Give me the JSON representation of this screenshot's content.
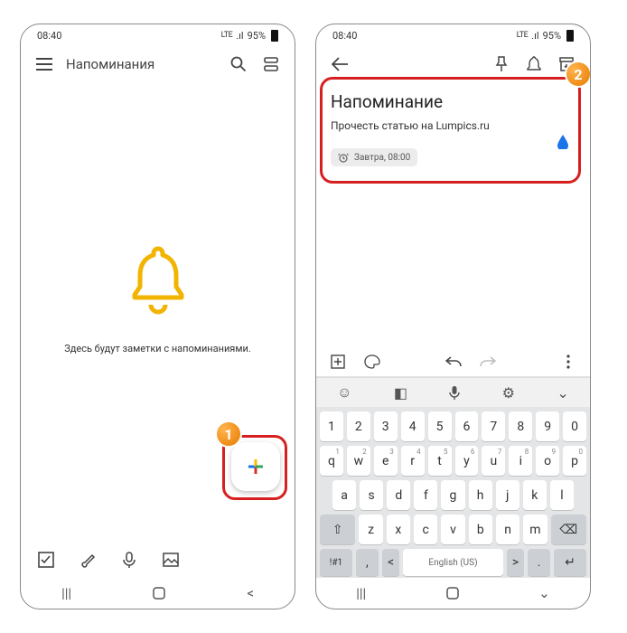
{
  "status": {
    "time": "08:40",
    "net": "LTE",
    "battery": "95%"
  },
  "screen1": {
    "title": "Напоминания",
    "empty": "Здесь будут заметки с напоминаниями.",
    "badge": "1"
  },
  "screen2": {
    "noteTitle": "Напоминание",
    "noteBody": "Прочесть статью на Lumpics.ru",
    "chip": "Завтра, 08:00",
    "badge": "2",
    "keyboard": {
      "row1": [
        "1",
        "2",
        "3",
        "4",
        "5",
        "6",
        "7",
        "8",
        "9",
        "0"
      ],
      "row2": [
        "q",
        "w",
        "e",
        "r",
        "t",
        "y",
        "u",
        "i",
        "o",
        "p"
      ],
      "row3": [
        "a",
        "s",
        "d",
        "f",
        "g",
        "h",
        "j",
        "k",
        "l"
      ],
      "row4": [
        "z",
        "x",
        "c",
        "v",
        "b",
        "n",
        "m"
      ],
      "shift": "⇧",
      "back": "⌫",
      "sym": "!#1",
      "comma": ",",
      "lang": "English (US)",
      "dot": ".",
      "enter": "↵",
      "langL": "<",
      "langR": ">"
    }
  }
}
